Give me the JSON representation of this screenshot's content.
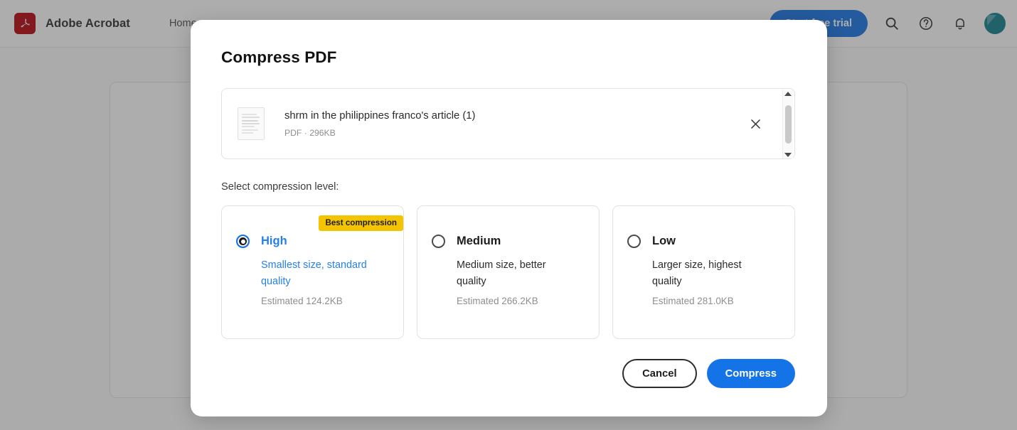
{
  "topbar": {
    "brand": "Adobe Acrobat",
    "logo_icon": "acrobat-logo-icon",
    "nav_items": [
      {
        "label": "Home"
      }
    ],
    "trial_button": "Start free trial",
    "icons": [
      {
        "name": "search-icon"
      },
      {
        "name": "help-icon"
      },
      {
        "name": "notifications-bell-icon"
      }
    ],
    "avatar_name": "user-avatar",
    "avatar_color": "#0D7C8C",
    "accent_color": "#1473E6"
  },
  "modal": {
    "title": "Compress PDF",
    "file": {
      "name": "shrm in the philippines franco's article (1)",
      "meta": "PDF · 296KB",
      "thumbnail_icon": "pdf-document-thumbnail-icon",
      "remove_icon": "close-x-icon"
    },
    "scrollbar": {
      "up_icon": "scroll-up-arrow-icon",
      "down_icon": "scroll-down-arrow-icon"
    },
    "level_label": "Select compression level:",
    "levels": [
      {
        "id": "high",
        "title": "High",
        "description": "Smallest size, standard quality",
        "estimate": "Estimated 124.2KB",
        "badge": "Best compression",
        "selected": true
      },
      {
        "id": "medium",
        "title": "Medium",
        "description": "Medium size, better quality",
        "estimate": "Estimated 266.2KB",
        "badge": "",
        "selected": false
      },
      {
        "id": "low",
        "title": "Low",
        "description": "Larger size, highest quality",
        "estimate": "Estimated 281.0KB",
        "badge": "",
        "selected": false
      }
    ],
    "cancel_label": "Cancel",
    "compress_label": "Compress",
    "badge_color": "#F5C400",
    "selected_color": "#2680EB"
  }
}
